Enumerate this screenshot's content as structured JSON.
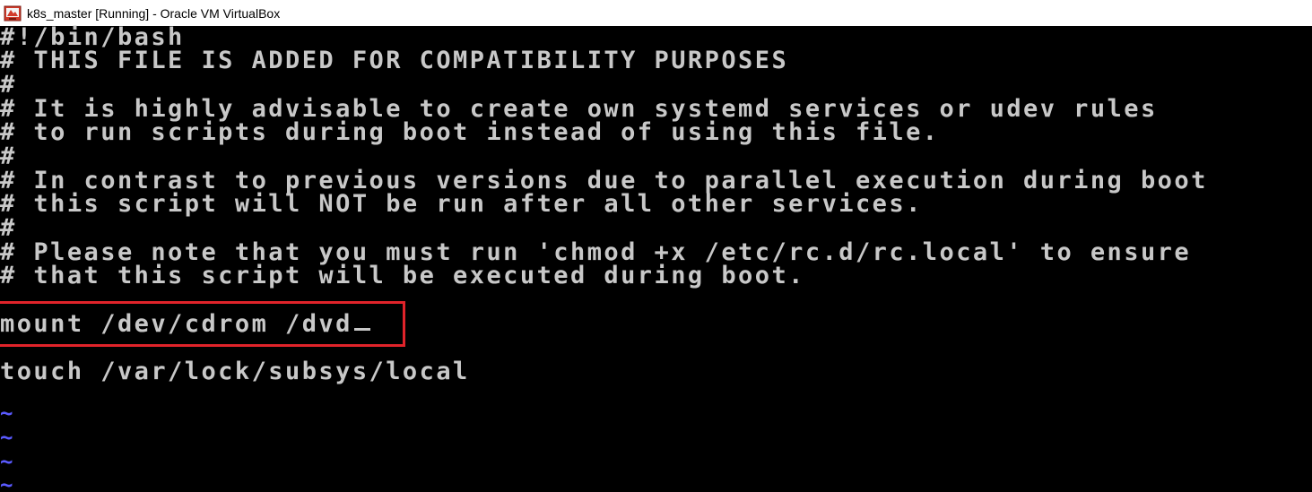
{
  "window": {
    "title": "k8s_master [Running] - Oracle VM VirtualBox",
    "icon": "virtualbox-icon"
  },
  "terminal": {
    "lines": [
      "#!/bin/bash",
      "# THIS FILE IS ADDED FOR COMPATIBILITY PURPOSES",
      "#",
      "# It is highly advisable to create own systemd services or udev rules",
      "# to run scripts during boot instead of using this file.",
      "#",
      "# In contrast to previous versions due to parallel execution during boot",
      "# this script will NOT be run after all other services.",
      "#",
      "# Please note that you must run 'chmod +x /etc/rc.d/rc.local' to ensure",
      "# that this script will be executed during boot."
    ],
    "highlighted_line": "mount /dev/cdrom /dvd",
    "last_line": "touch /var/lock/subsys/local",
    "tildes": [
      "~",
      "~",
      "~",
      "~"
    ],
    "colors": {
      "text": "#c8c8c8",
      "tilde": "#5a5aff",
      "highlight": "#e0232a",
      "background": "#000000"
    }
  }
}
